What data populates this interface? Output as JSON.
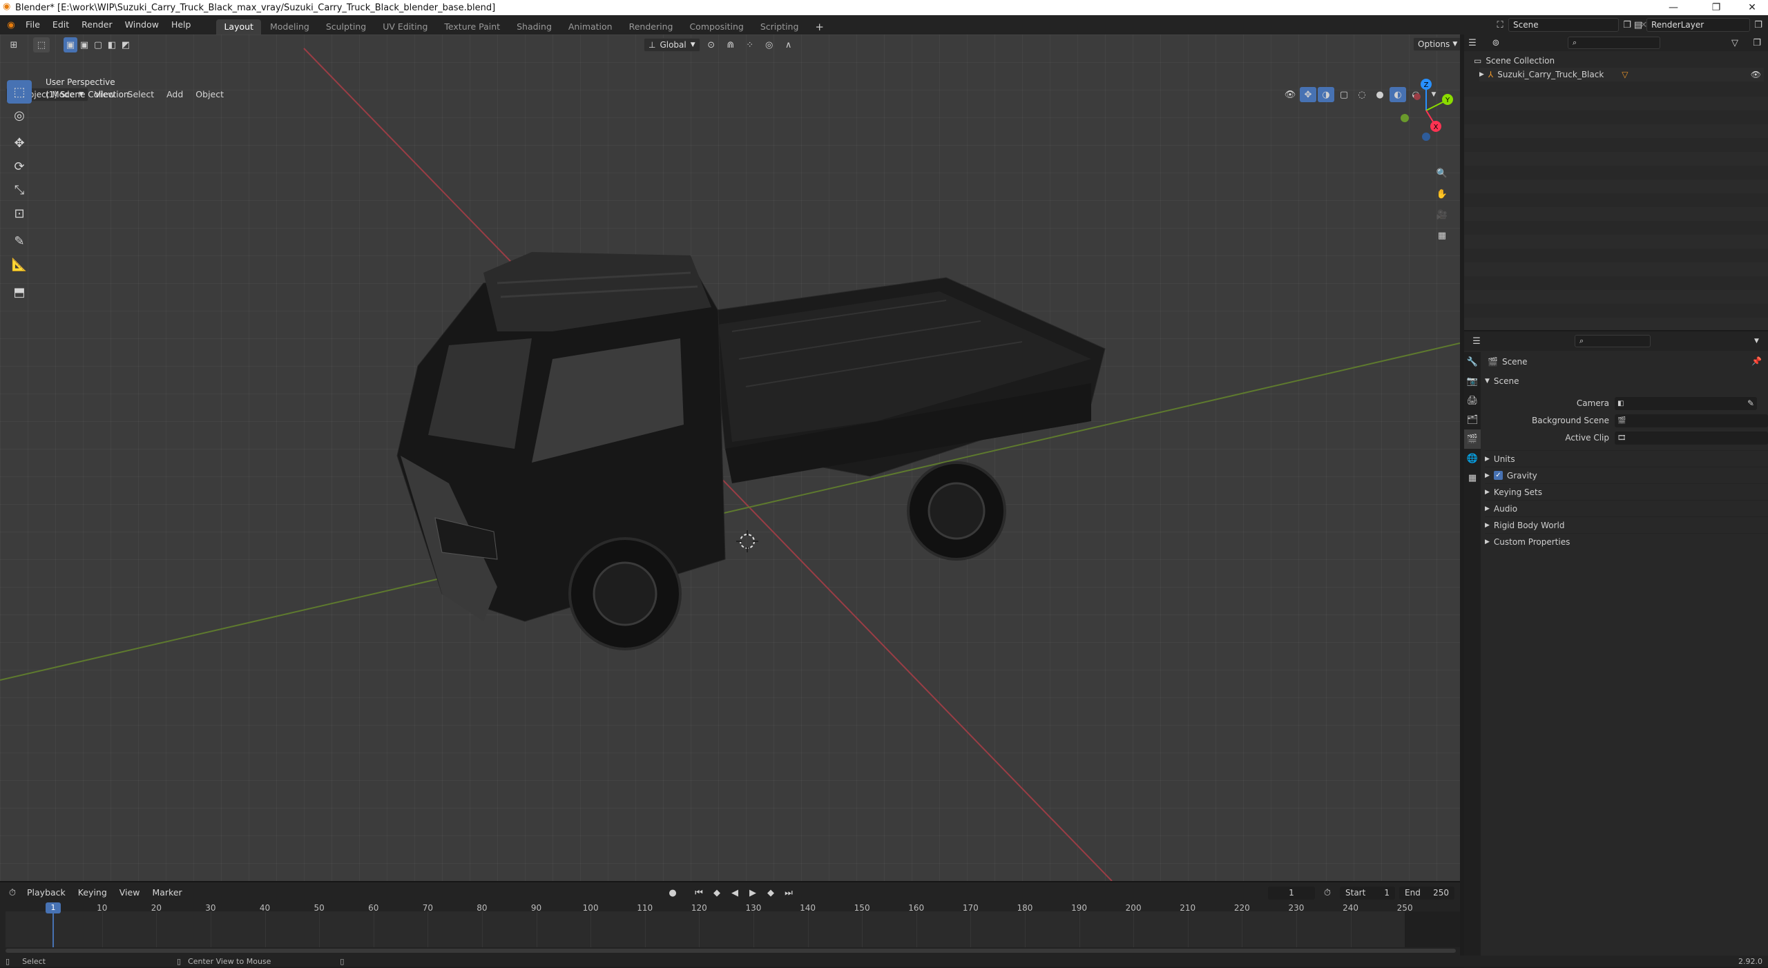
{
  "window": {
    "title": "Blender* [E:\\work\\WIP\\Suzuki_Carry_Truck_Black_max_vray/Suzuki_Carry_Truck_Black_blender_base.blend]",
    "minimize": "—",
    "maximize": "❐",
    "close": "✕"
  },
  "menu": {
    "items": [
      "File",
      "Edit",
      "Render",
      "Window",
      "Help"
    ]
  },
  "workspaces": {
    "tabs": [
      "Layout",
      "Modeling",
      "Sculpting",
      "UV Editing",
      "Texture Paint",
      "Shading",
      "Animation",
      "Rendering",
      "Compositing",
      "Scripting"
    ],
    "active": "Layout",
    "add": "+"
  },
  "scene_selector": {
    "value": "Scene"
  },
  "viewlayer_selector": {
    "value": "RenderLayer"
  },
  "viewport": {
    "mode": "Object Mode",
    "menus": [
      "View",
      "Select",
      "Add",
      "Object"
    ],
    "transform_orientation": "Global",
    "options_label": "Options",
    "overlay_text_1": "User Perspective",
    "overlay_text_2": "(1) Scene Collection",
    "gizmo_axes": {
      "x": "X",
      "y": "Y",
      "z": "Z"
    }
  },
  "outliner": {
    "root": "Scene Collection",
    "items": [
      {
        "label": "Suzuki_Carry_Truck_Black"
      }
    ]
  },
  "properties": {
    "context_title": "Scene",
    "panel_title": "Scene",
    "fields": [
      {
        "label": "Camera",
        "value": ""
      },
      {
        "label": "Background Scene",
        "value": ""
      },
      {
        "label": "Active Clip",
        "value": ""
      }
    ],
    "subpanels": [
      "Units",
      "Gravity",
      "Keying Sets",
      "Audio",
      "Rigid Body World",
      "Custom Properties"
    ],
    "gravity_checked": true
  },
  "timeline": {
    "menus": [
      "Playback",
      "Keying",
      "View",
      "Marker"
    ],
    "current_frame": "1",
    "start_label": "Start",
    "start": "1",
    "end_label": "End",
    "end": "250",
    "ticks": [
      "10",
      "20",
      "30",
      "40",
      "50",
      "60",
      "70",
      "80",
      "90",
      "100",
      "110",
      "120",
      "130",
      "140",
      "150",
      "160",
      "170",
      "180",
      "190",
      "200",
      "210",
      "220",
      "230",
      "240",
      "250"
    ],
    "playhead_label": "1"
  },
  "statusbar": {
    "left": "Select",
    "middle": "Center View to Mouse",
    "version": "2.92.0"
  },
  "colors": {
    "accent": "#4772b3",
    "x_axis": "#ff3352",
    "y_axis": "#8bdc00",
    "z_axis": "#2890ff",
    "viewport_bg": "#3c3c3c"
  }
}
